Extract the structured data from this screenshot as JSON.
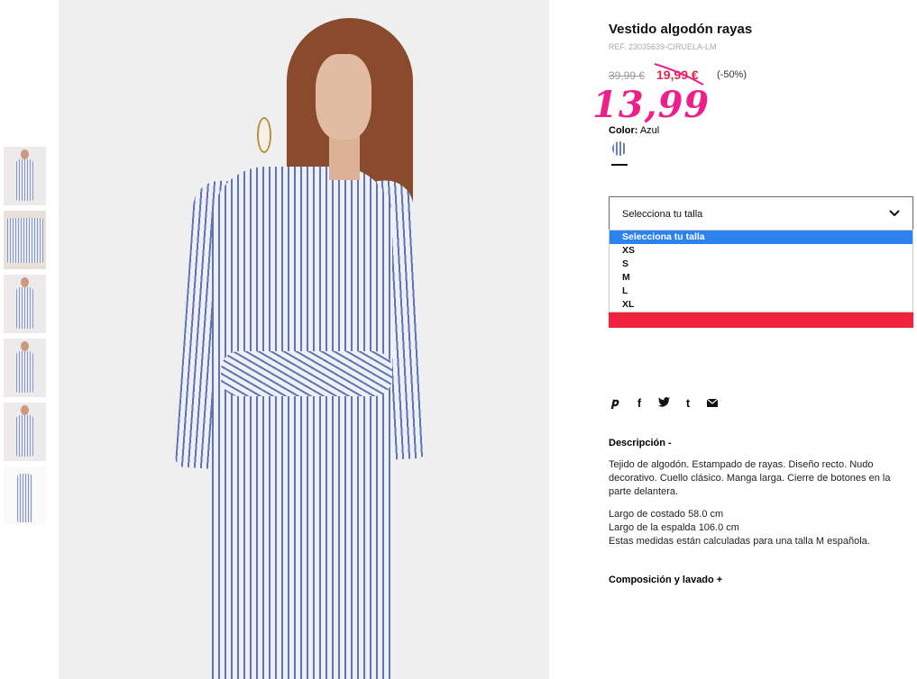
{
  "product": {
    "title": "Vestido algodón rayas",
    "reference": "REF. 23035639-CIRUELA-LM",
    "old_price": "39,99 €",
    "sale_price": "19,99 €",
    "discount": "(-50%)",
    "handwritten_price": "13,99",
    "color_label": "Color:",
    "color_value": "Azul"
  },
  "size_select": {
    "selected": "Selecciona tu talla",
    "options": [
      "Selecciona tu talla",
      "XS",
      "S",
      "M",
      "L",
      "XL"
    ]
  },
  "social_icons": [
    "pinterest-icon",
    "facebook-icon",
    "twitter-icon",
    "tumblr-icon",
    "mail-icon"
  ],
  "description": {
    "title": "Descripción -",
    "text": "Tejido de algodón. Estampado de rayas. Diseño recto. Nudo decorativo. Cuello clásico. Manga larga. Cierre de botones en la parte delantera.",
    "measures": [
      "Largo de costado 58.0 cm",
      "Largo de la espalda 106.0 cm",
      "Estas medidas están calculadas para una talla M española."
    ]
  },
  "composition_label": "Composición y lavado +",
  "colors": {
    "sale": "#e5264a",
    "handwritten": "#ee1f8a",
    "highlight": "#2c83f0",
    "add_to_cart": "#f0233f"
  }
}
